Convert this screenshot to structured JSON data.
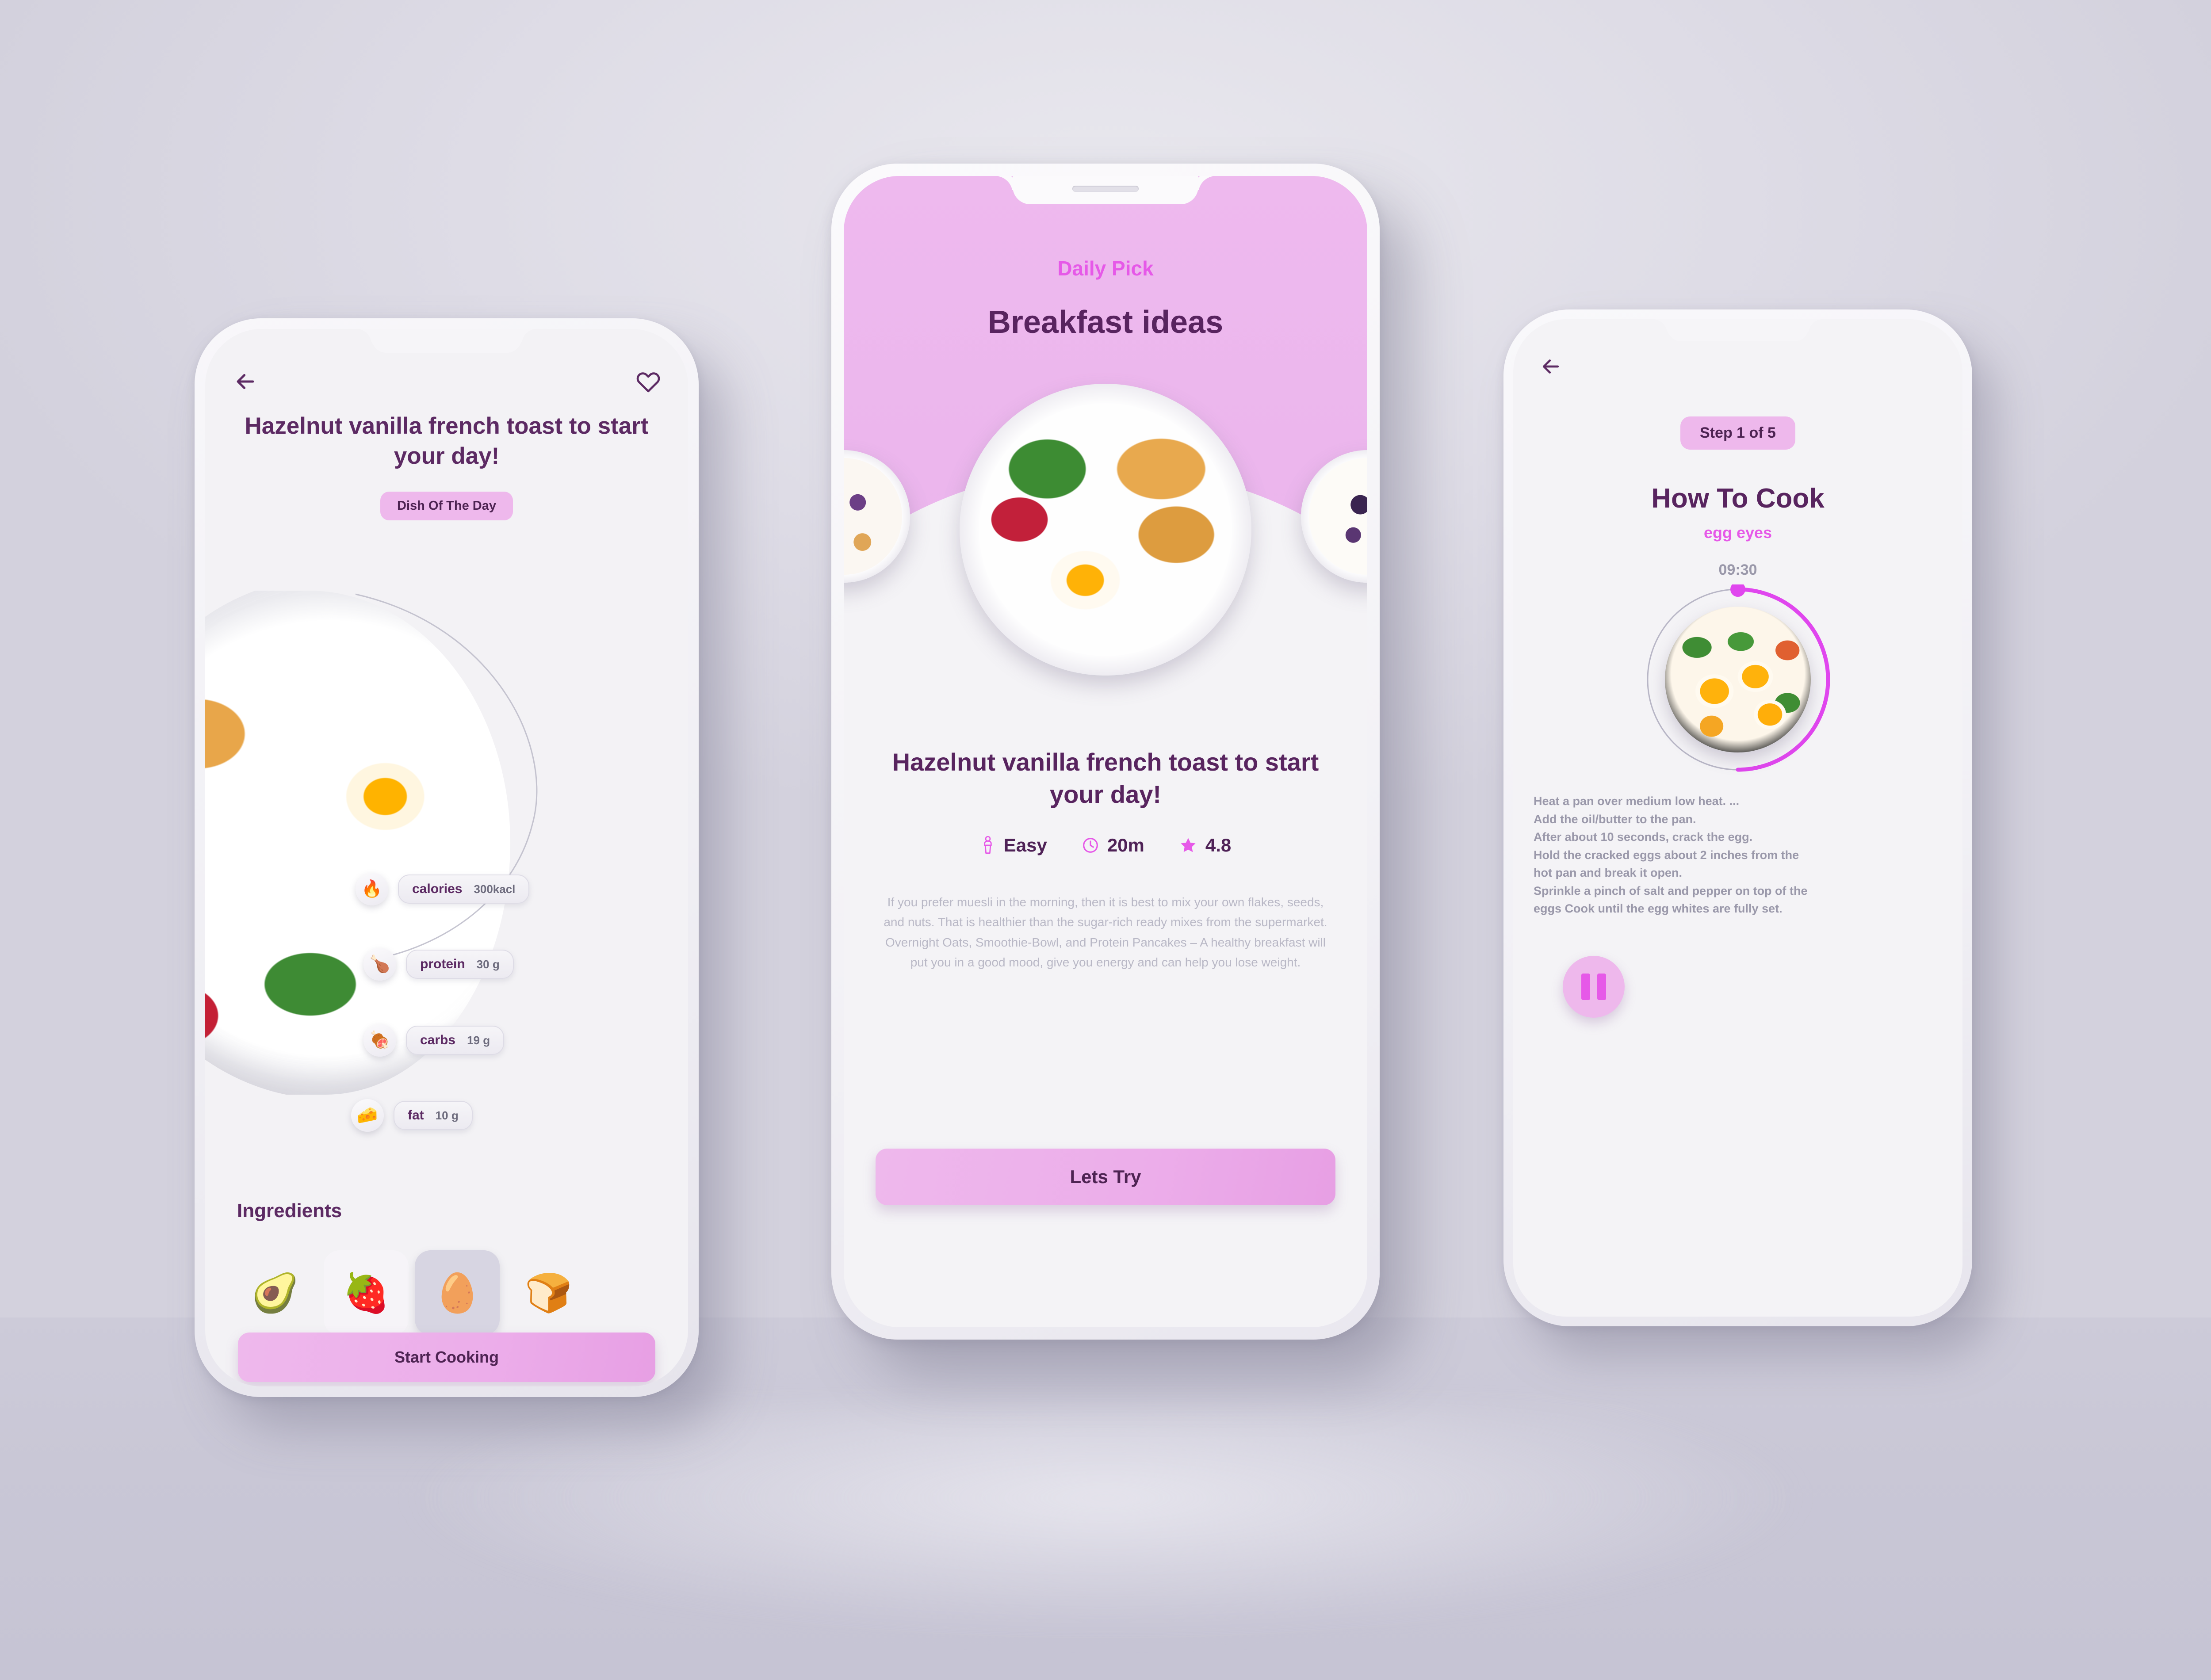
{
  "theme": {
    "accent_pink": "#eeb8ec",
    "accent_magenta": "#e659e8",
    "text_purple": "#58245f",
    "muted_grey": "#9a98aa",
    "background": "#d6d4e0"
  },
  "screen_detail": {
    "back_icon": "arrow-left-icon",
    "favorite_icon": "heart-outline-icon",
    "title": "Hazelnut vanilla french toast to start your day!",
    "badge": "Dish Of The Day",
    "nutrition": [
      {
        "icon": "🔥",
        "label": "calories",
        "value": "300kacl"
      },
      {
        "icon": "🍗",
        "label": "protein",
        "value": "30 g"
      },
      {
        "icon": "🍖",
        "label": "carbs",
        "value": "19 g"
      },
      {
        "icon": "🧀",
        "label": "fat",
        "value": "10 g"
      }
    ],
    "ingredients_heading": "Ingredients",
    "ingredients": [
      {
        "icon": "🥑",
        "name": "avocado",
        "selected": false
      },
      {
        "icon": "🍓",
        "name": "strawberry",
        "selected": false
      },
      {
        "icon": "🥚",
        "name": "egg",
        "selected": true
      },
      {
        "icon": "🍞",
        "name": "bread",
        "selected": false
      }
    ],
    "cta": "Start Cooking"
  },
  "screen_daily": {
    "kicker": "Daily Pick",
    "title": "Breakfast ideas",
    "carousel": [
      {
        "name": "yogurt-bowl"
      },
      {
        "name": "french-toast-plate"
      },
      {
        "name": "berry-bowl"
      }
    ],
    "recipe_title": "Hazelnut vanilla french toast to start your day!",
    "meta": [
      {
        "icon": "chef-icon",
        "label": "Easy"
      },
      {
        "icon": "clock-icon",
        "label": "20m"
      },
      {
        "icon": "star-icon",
        "label": "4.8"
      }
    ],
    "description": "If you prefer muesli in the morning, then it is best to mix your own flakes, seeds, and nuts. That is healthier than the sugar-rich ready mixes from the supermarket. Overnight Oats, Smoothie-Bowl, and Protein Pancakes – A healthy breakfast will put you in a good mood, give you energy and can help you lose weight.",
    "cta": "Lets Try"
  },
  "screen_cook": {
    "back_icon": "arrow-left-icon",
    "step_badge": "Step 1 of 5",
    "title": "How To Cook",
    "subtitle": "egg eyes",
    "timer": "09:30",
    "steps": [
      "Heat a pan over medium low heat. ...",
      "Add the oil/butter to the pan.",
      "After about 10 seconds, crack the egg.",
      "Hold the cracked eggs about 2 inches from the",
      " hot pan and break it open.",
      "Sprinkle a pinch of salt and pepper on top of the",
      "eggs Cook until the egg whites are fully set."
    ],
    "pause_icon": "pause-icon"
  }
}
